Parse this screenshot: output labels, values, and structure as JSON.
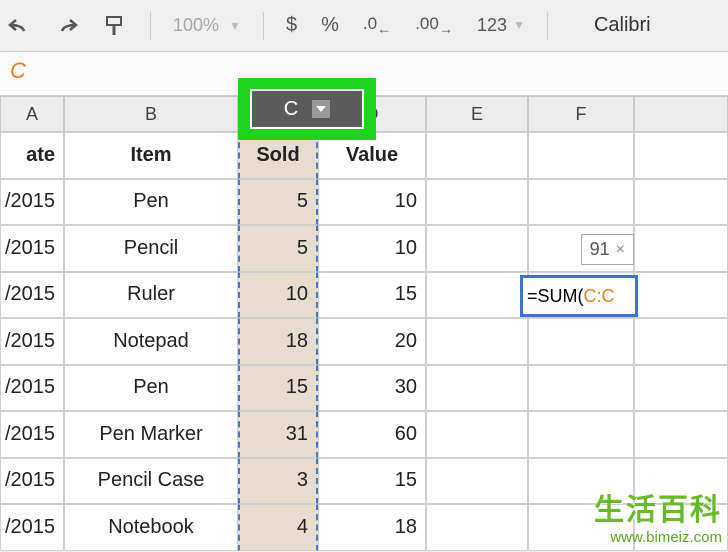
{
  "toolbar": {
    "zoom": "100%",
    "currency": "$",
    "percent": "%",
    "dec_less": ".0",
    "dec_more": ".00",
    "numfmt": "123",
    "font": "Calibri"
  },
  "formula_bar": "C",
  "columns": {
    "A": "A",
    "B": "B",
    "C": "C",
    "D": "D",
    "E": "E",
    "F": "F"
  },
  "headers": {
    "date": "ate",
    "item": "Item",
    "sold": "Sold",
    "value": "Value"
  },
  "rows": [
    {
      "date": "/2015",
      "item": "Pen",
      "sold": "5",
      "value": "10"
    },
    {
      "date": "/2015",
      "item": "Pencil",
      "sold": "5",
      "value": "10"
    },
    {
      "date": "/2015",
      "item": "Ruler",
      "sold": "10",
      "value": "15"
    },
    {
      "date": "/2015",
      "item": "Notepad",
      "sold": "18",
      "value": "20"
    },
    {
      "date": "/2015",
      "item": "Pen",
      "sold": "15",
      "value": "30"
    },
    {
      "date": "/2015",
      "item": "Pen Marker",
      "sold": "31",
      "value": "60"
    },
    {
      "date": "/2015",
      "item": "Pencil Case",
      "sold": "3",
      "value": "15"
    },
    {
      "date": "/2015",
      "item": "Notebook",
      "sold": "4",
      "value": "18"
    }
  ],
  "tooltip": {
    "value": "91",
    "close": "×"
  },
  "formula": {
    "prefix": "=SUM(",
    "ref": "C:C"
  },
  "watermark": {
    "cn": "生活百科",
    "url": "www.bimeiz.com"
  }
}
